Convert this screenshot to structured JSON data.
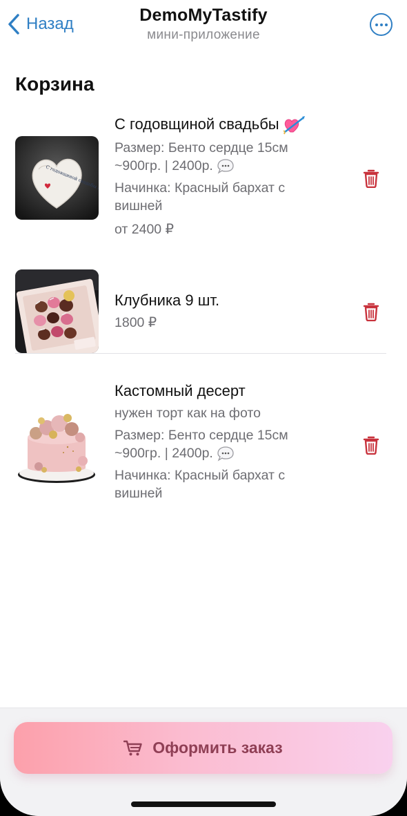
{
  "header": {
    "back_label": "Назад",
    "title": "DemoMyTastify",
    "subtitle": "мини-приложение"
  },
  "page_title": "Корзина",
  "items": [
    {
      "name": "С годовщиной свадьбы",
      "name_icon": "heart-with-arrow-emoji",
      "size_text": "Размер: Бенто сердце 15см ~900гр. | 2400р.",
      "size_icon": "speech-bubble-emoji",
      "filling_text": "Начинка: Красный бархат с вишней",
      "price": "от 2400 ₽",
      "cake_inscription": "С годовщиной свадьбы любимый!"
    },
    {
      "name": "Клубника 9 шт.",
      "price": "1800 ₽"
    },
    {
      "name": "Кастомный десерт",
      "note": "нужен торт как на фото",
      "size_text": "Размер: Бенто сердце 15см ~900гр. | 2400р.",
      "size_icon": "speech-bubble-emoji",
      "filling_text": "Начинка: Красный бархат с вишней"
    }
  ],
  "footer": {
    "checkout_label": "Оформить заказ",
    "checkout_icon": "cart-icon"
  },
  "colors": {
    "accent": "#2f7fc4",
    "trash": "#c8323c",
    "checkout_text": "#8f3f55",
    "checkout_gradient_start": "#fca0ab",
    "checkout_gradient_end": "#f9d1ee"
  }
}
